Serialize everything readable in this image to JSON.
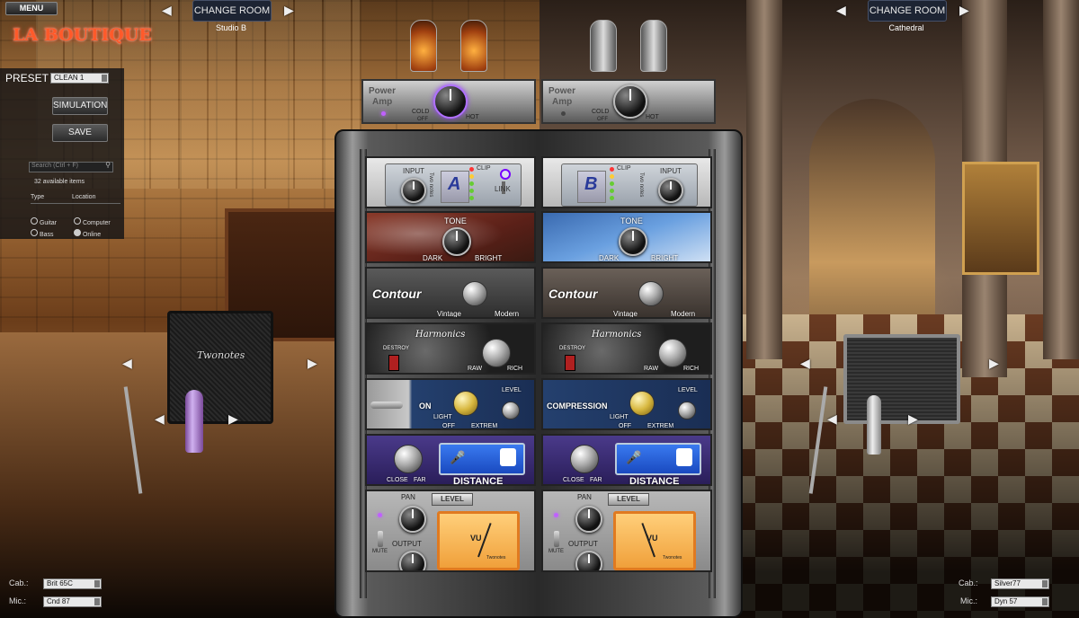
{
  "header": {
    "menu_label": "MENU",
    "logo": "LA BOUTIQUE",
    "left_room": {
      "button": "CHANGE ROOM",
      "name": "Studio B"
    },
    "right_room": {
      "button": "CHANGE ROOM",
      "name": "Cathedral"
    }
  },
  "left_panel": {
    "preset_label": "PRESET",
    "preset_value": "CLEAN 1",
    "simulation_label": "SIMULATION",
    "save_label": "SAVE",
    "search_placeholder": "Search (Ctrl + F)",
    "available_items": "32 available items",
    "type_header": "Type",
    "location_header": "Location",
    "type_options": [
      "Guitar",
      "Bass"
    ],
    "location_options": [
      "Computer",
      "Online"
    ]
  },
  "power_amp": {
    "left": {
      "title_line1": "Power",
      "title_line2": "Amp",
      "cold": "COLD",
      "off": "OFF",
      "hot": "HOT"
    },
    "right": {
      "title_line1": "Power",
      "title_line2": "Amp",
      "cold": "COLD",
      "off": "OFF",
      "hot": "HOT"
    }
  },
  "rack": {
    "input": {
      "left": {
        "input_label": "INPUT",
        "channel": "A",
        "clip": "CLIP",
        "link": "LINK",
        "brand": "Two notes"
      },
      "right": {
        "input_label": "INPUT",
        "channel": "B",
        "clip": "CLIP",
        "brand": "Two notes"
      }
    },
    "tone": {
      "title": "TONE",
      "dark": "DARK",
      "bright": "BRIGHT"
    },
    "contour": {
      "title": "Contour",
      "vintage": "Vintage",
      "modern": "Modern"
    },
    "harmonics": {
      "title": "Harmonics",
      "destroy": "DESTROY",
      "raw": "RAW",
      "rich": "RICH"
    },
    "compression": {
      "left_title": "ON",
      "right_title": "COMPRESSION",
      "light": "LIGHT",
      "extrem": "EXTREM",
      "off": "OFF",
      "level": "LEVEL"
    },
    "distance": {
      "title": "DISTANCE",
      "close": "CLOSE",
      "far": "FAR"
    },
    "level": {
      "badge": "LEVEL",
      "pan": "PAN",
      "output": "OUTPUT",
      "mute": "MUTE",
      "vu": "VU",
      "brand": "Twonotes"
    }
  },
  "cabinet": {
    "left_brand": "Twonotes"
  },
  "bottom": {
    "left": {
      "cab_label": "Cab.:",
      "cab_value": "Brit 65C",
      "mic_label": "Mic.:",
      "mic_value": "Cnd 87"
    },
    "right": {
      "cab_label": "Cab.:",
      "cab_value": "Silver77",
      "mic_label": "Mic.:",
      "mic_value": "Dyn 57"
    }
  },
  "colors": {
    "logo": "#ff5a2a",
    "change_room_bg": "#1d2433",
    "tone_left": "#7a2e22",
    "tone_right": "#5a8fd0",
    "distance": "#3a2a7a",
    "compression": "#24406e"
  }
}
